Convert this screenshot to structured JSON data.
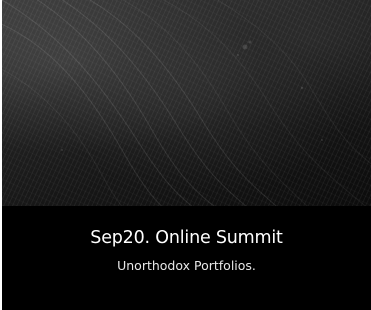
{
  "card": {
    "title": "Sep20. Online Summit",
    "subtitle": "Unorthodox Portfolios."
  },
  "colors": {
    "caption_background": "#000000",
    "caption_text": "#ffffff"
  }
}
